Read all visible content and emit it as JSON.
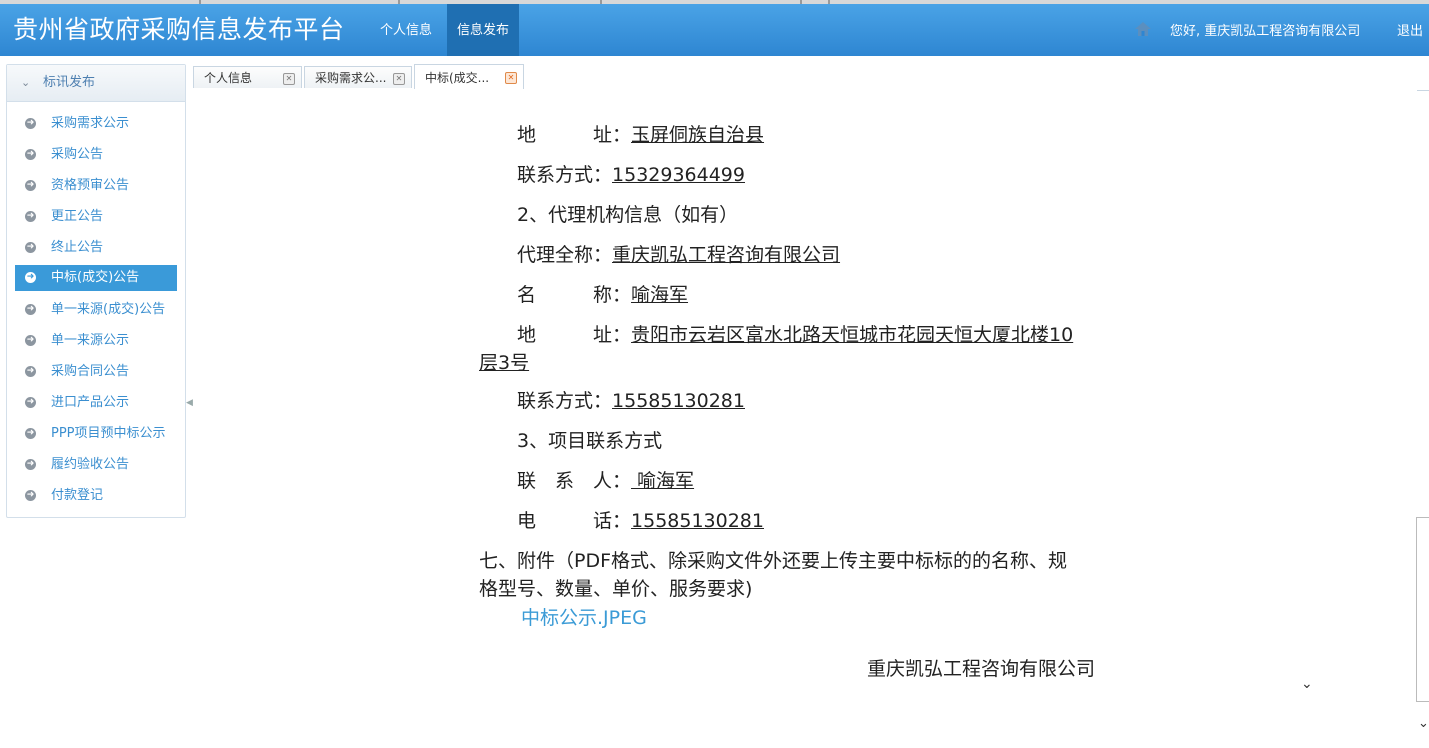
{
  "app": {
    "title": "贵州省政府采购信息发布平台",
    "nav": [
      "个人信息",
      "信息发布"
    ],
    "greeting": "您好, 重庆凯弘工程咨询有限公司",
    "logout": "退出"
  },
  "sidebar": {
    "header": "标讯发布",
    "items": [
      {
        "label": "采购需求公示"
      },
      {
        "label": "采购公告"
      },
      {
        "label": "资格预审公告"
      },
      {
        "label": "更正公告"
      },
      {
        "label": "终止公告"
      },
      {
        "label": "中标(成交)公告",
        "active": true
      },
      {
        "label": "单一来源(成交)公告"
      },
      {
        "label": "单一来源公示"
      },
      {
        "label": "采购合同公告"
      },
      {
        "label": "进口产品公示"
      },
      {
        "label": "PPP项目预中标公示"
      },
      {
        "label": "履约验收公告"
      },
      {
        "label": "付款登记"
      }
    ]
  },
  "tabs": [
    {
      "label": "个人信息"
    },
    {
      "label": "采购需求公..."
    },
    {
      "label": "中标(成交..."
    }
  ],
  "doc": {
    "address1_label": "地　　　址：",
    "address1_value": "玉屏侗族自治县",
    "contact1_label": "联系方式：",
    "contact1_value": "15329364499",
    "sec2": "2、代理机构信息（如有）",
    "agency_full_label": "代理全称：",
    "agency_full_value": "重庆凯弘工程咨询有限公司",
    "name_label": "名　　　称：",
    "name_value": "喻海军",
    "address2_label": "地　　　址：",
    "address2_value_a": "贵阳市云岩区富水北路天恒城市花园天恒大厦北楼10",
    "address2_value_b": "层3号",
    "contact2_label": "联系方式：",
    "contact2_value": "15585130281",
    "sec3": "3、项目联系方式",
    "person_label": "联　系　人：",
    "person_value": " 喻海军",
    "phone_label": "电　　　话：",
    "phone_value": "15585130281",
    "sec7_a": "七、附件（PDF格式、除采购文件外还要上传主要中标标的的名称、规",
    "sec7_b": "格型号、数量、单价、服务要求)",
    "attachment": "中标公示.JPEG",
    "signature": "重庆凯弘工程咨询有限公司"
  }
}
